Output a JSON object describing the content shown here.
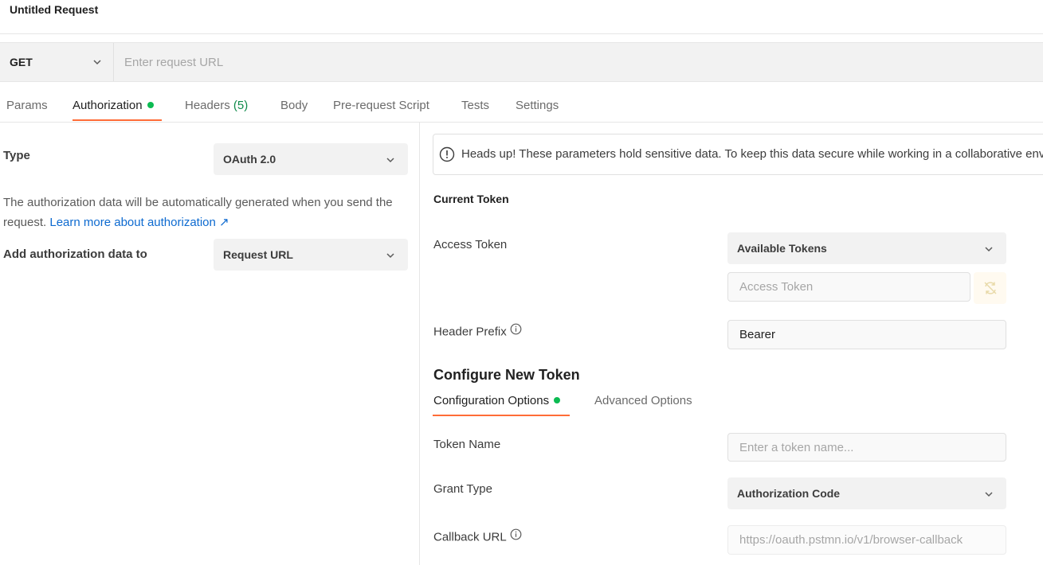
{
  "header": {
    "title": "Untitled Request"
  },
  "request": {
    "method": "GET",
    "url_value": "",
    "url_placeholder": "Enter request URL"
  },
  "tabs": [
    {
      "label": "Params",
      "active": false
    },
    {
      "label": "Authorization",
      "active": true,
      "indicator_dot": true
    },
    {
      "label": "Headers",
      "count": "(5)",
      "active": false
    },
    {
      "label": "Body",
      "active": false
    },
    {
      "label": "Pre-request Script",
      "active": false
    },
    {
      "label": "Tests",
      "active": false
    },
    {
      "label": "Settings",
      "active": false
    }
  ],
  "auth": {
    "type_label": "Type",
    "type_value": "OAuth 2.0",
    "description": "The authorization data will be automatically generated when you send the request.",
    "learn_more_link": "Learn more about authorization ↗",
    "add_to_label": "Add authorization data to",
    "add_to_value": "Request URL"
  },
  "oauth": {
    "alert_text": "Heads up! These parameters hold sensitive data. To keep this data secure while working in a collaborative environment, we recommend using variables.",
    "current_token_heading": "Current Token",
    "access_token_label": "Access Token",
    "available_tokens_value": "Available Tokens",
    "access_token_value": "",
    "access_token_placeholder": "Access Token",
    "header_prefix_label": "Header Prefix",
    "header_prefix_value": "Bearer",
    "configure_heading": "Configure New Token",
    "sub_tabs": [
      {
        "label": "Configuration Options",
        "active": true,
        "indicator_dot": true
      },
      {
        "label": "Advanced Options",
        "active": false
      }
    ],
    "token_name_label": "Token Name",
    "token_name_value": "",
    "token_name_placeholder": "Enter a token name...",
    "grant_type_label": "Grant Type",
    "grant_type_value": "Authorization Code",
    "callback_url_label": "Callback URL",
    "callback_url_value": "https://oauth.pstmn.io/v1/browser-callback"
  },
  "colors": {
    "accent": "#ff6c37",
    "success_dot": "#0cbb52",
    "link": "#0d6ad0",
    "count": "#0f8a4a"
  }
}
